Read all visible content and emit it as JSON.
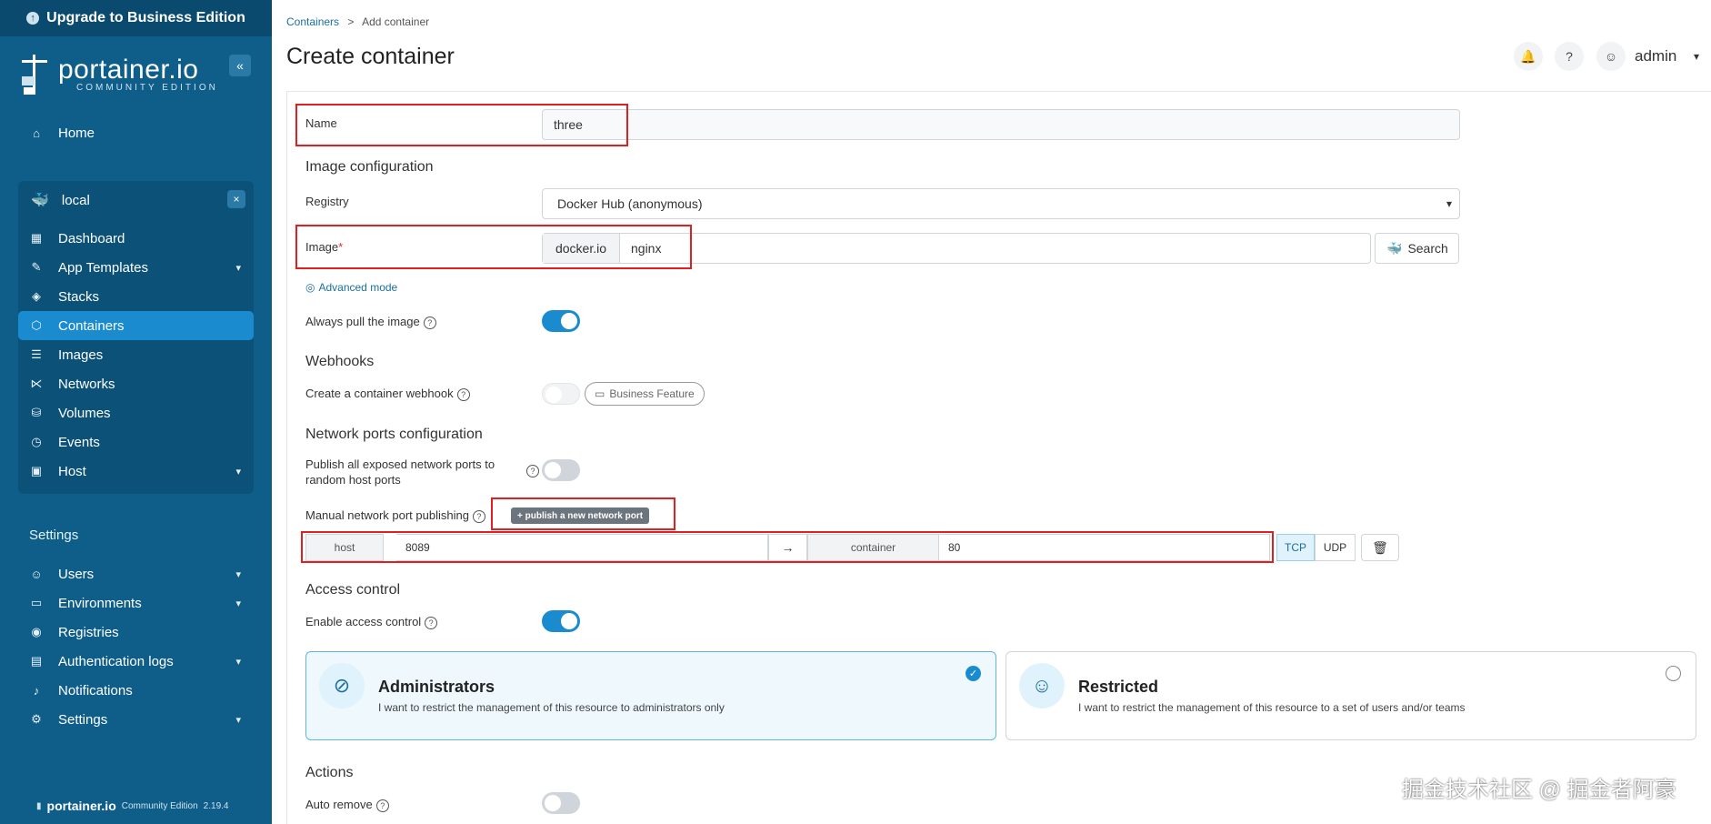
{
  "upgrade_label": "Upgrade to Business Edition",
  "logo": {
    "title": "portainer.io",
    "subtitle": "COMMUNITY EDITION"
  },
  "nav_home": "Home",
  "env": {
    "name": "local",
    "items": [
      "Dashboard",
      "App Templates",
      "Stacks",
      "Containers",
      "Images",
      "Networks",
      "Volumes",
      "Events",
      "Host"
    ]
  },
  "settings": {
    "heading": "Settings",
    "items": [
      "Users",
      "Environments",
      "Registries",
      "Authentication logs",
      "Notifications",
      "Settings"
    ]
  },
  "footer": {
    "brand": "portainer.io",
    "edition": "Community Edition",
    "version": "2.19.4"
  },
  "breadcrumb": {
    "parent": "Containers",
    "sep": ">",
    "current": "Add container"
  },
  "page_title": "Create container",
  "user": "admin",
  "form": {
    "name_label": "Name",
    "name_value": "three",
    "image_config_heading": "Image configuration",
    "registry_label": "Registry",
    "registry_value": "Docker Hub (anonymous)",
    "image_label": "Image",
    "required_mark": "*",
    "image_prefix": "docker.io",
    "image_value": "nginx",
    "search_label": "Search",
    "advanced_mode": "Advanced mode",
    "always_pull_label": "Always pull the image",
    "webhooks_heading": "Webhooks",
    "webhook_label": "Create a container webhook",
    "business_feature": "Business Feature",
    "network_heading": "Network ports configuration",
    "publish_all_label": "Publish all exposed network ports to random host ports",
    "manual_label": "Manual network port publishing",
    "publish_new_btn": "+ publish a new network port",
    "host_label": "host",
    "host_value": "8089",
    "container_label": "container",
    "container_value": "80",
    "tcp": "TCP",
    "udp": "UDP",
    "access_heading": "Access control",
    "enable_access_label": "Enable access control",
    "admin_title": "Administrators",
    "admin_desc": "I want to restrict the management of this resource to administrators only",
    "restricted_title": "Restricted",
    "restricted_desc": "I want to restrict the management of this resource to a set of users and/or teams",
    "actions_heading": "Actions",
    "auto_remove_label": "Auto remove"
  },
  "watermark": "掘金技术社区 @ 掘金者阿豪"
}
